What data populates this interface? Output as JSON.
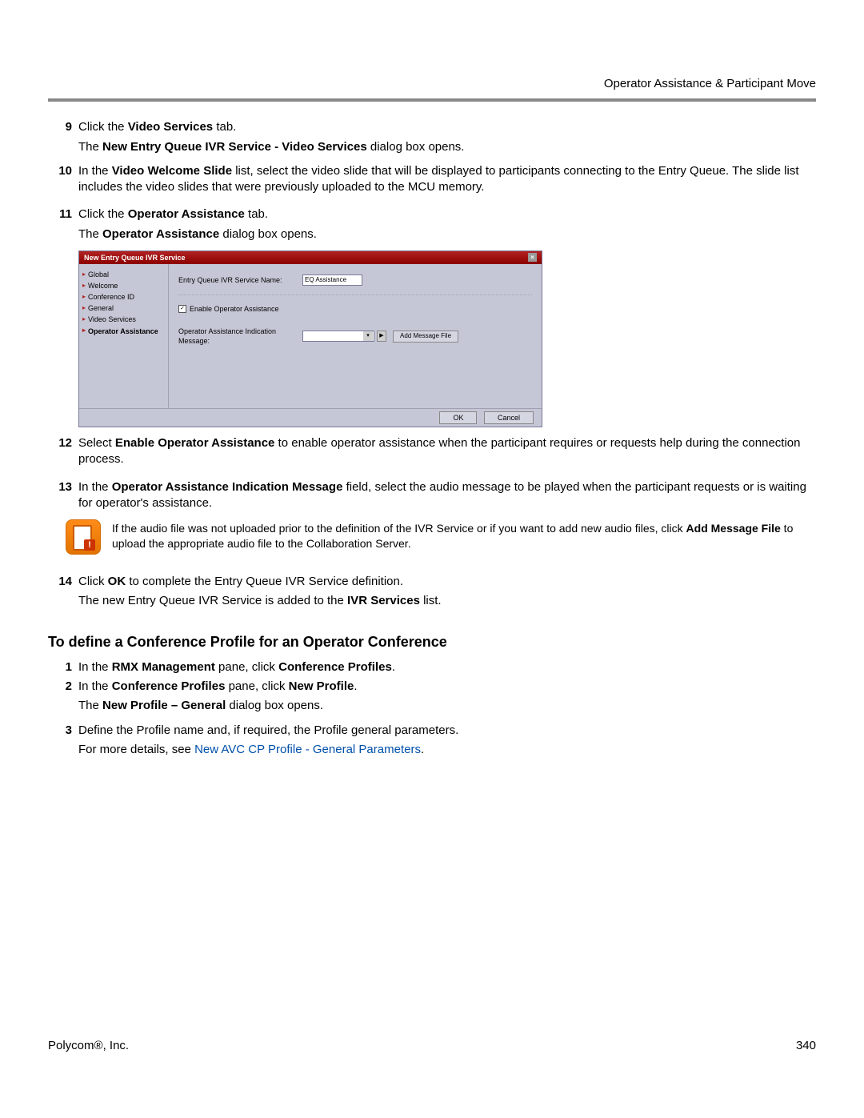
{
  "header": {
    "title": "Operator Assistance & Participant Move"
  },
  "steps_a": [
    {
      "num": "9",
      "line1_pre": "Click the ",
      "line1_bold": "Video Services",
      "line1_post": " tab.",
      "sub_pre": "The ",
      "sub_bold": "New Entry Queue IVR Service - Video Services",
      "sub_post": " dialog box opens."
    },
    {
      "num": "10",
      "line1_pre": "In the ",
      "line1_bold": "Video Welcome Slide",
      "line1_post": " list, select the video slide that will be displayed to participants connecting to the Entry Queue. The slide list includes the video slides that were previously uploaded to the MCU memory."
    },
    {
      "num": "11",
      "line1_pre": "Click the ",
      "line1_bold": "Operator Assistance",
      "line1_post": " tab.",
      "sub_pre": "The ",
      "sub_bold": "Operator Assistance",
      "sub_post": " dialog box opens."
    }
  ],
  "dialog": {
    "title": "New Entry Queue IVR Service",
    "nav": [
      "Global",
      "Welcome",
      "Conference ID",
      "General",
      "Video Services",
      "Operator Assistance"
    ],
    "active_nav": "Operator Assistance",
    "service_name_label": "Entry Queue IVR Service Name:",
    "service_name_value": "EQ Assistance",
    "checkbox_label": "Enable Operator Assistance",
    "msg_label": "Operator Assistance Indication Message:",
    "add_btn": "Add Message File",
    "ok": "OK",
    "cancel": "Cancel"
  },
  "steps_b": [
    {
      "num": "12",
      "line1_pre": "Select ",
      "line1_bold": "Enable Operator Assistance",
      "line1_post": " to enable operator assistance when the participant requires or requests help during the connection process."
    },
    {
      "num": "13",
      "line1_pre": "In the ",
      "line1_bold": "Operator Assistance Indication Message",
      "line1_post": " field, select the audio message to be played when the participant requests or is waiting for operator's assistance."
    }
  ],
  "note": {
    "pre": "If the audio file was not uploaded prior to the definition of the IVR Service or if you want to add new audio files, click ",
    "bold": "Add Message File",
    "post": " to upload the appropriate audio file to the Collaboration Server."
  },
  "steps_c": [
    {
      "num": "14",
      "line1_pre": "Click ",
      "line1_bold": "OK",
      "line1_post": " to complete the Entry Queue IVR Service definition.",
      "sub_pre": "The new Entry Queue IVR Service is added to the ",
      "sub_bold": "IVR Services",
      "sub_post": " list."
    }
  ],
  "section": {
    "heading": "To define a Conference Profile for an Operator Conference"
  },
  "steps_d": [
    {
      "num": "1",
      "pre": "In the ",
      "b1": "RMX Management",
      "mid": " pane, click ",
      "b2": "Conference Profiles",
      "post": "."
    },
    {
      "num": "2",
      "pre": "In the ",
      "b1": "Conference Profiles",
      "mid": " pane, click ",
      "b2": "New Profile",
      "post": ".",
      "sub_pre": "The ",
      "sub_bold": "New Profile – General",
      "sub_post": " dialog box opens."
    },
    {
      "num": "3",
      "plain": "Define the Profile name and, if required, the Profile general parameters.",
      "sub_pre": "For more details, see ",
      "sub_link": "New AVC CP Profile - General Parameters",
      "sub_post": "."
    }
  ],
  "footer": {
    "left": "Polycom®, Inc.",
    "right": "340"
  }
}
